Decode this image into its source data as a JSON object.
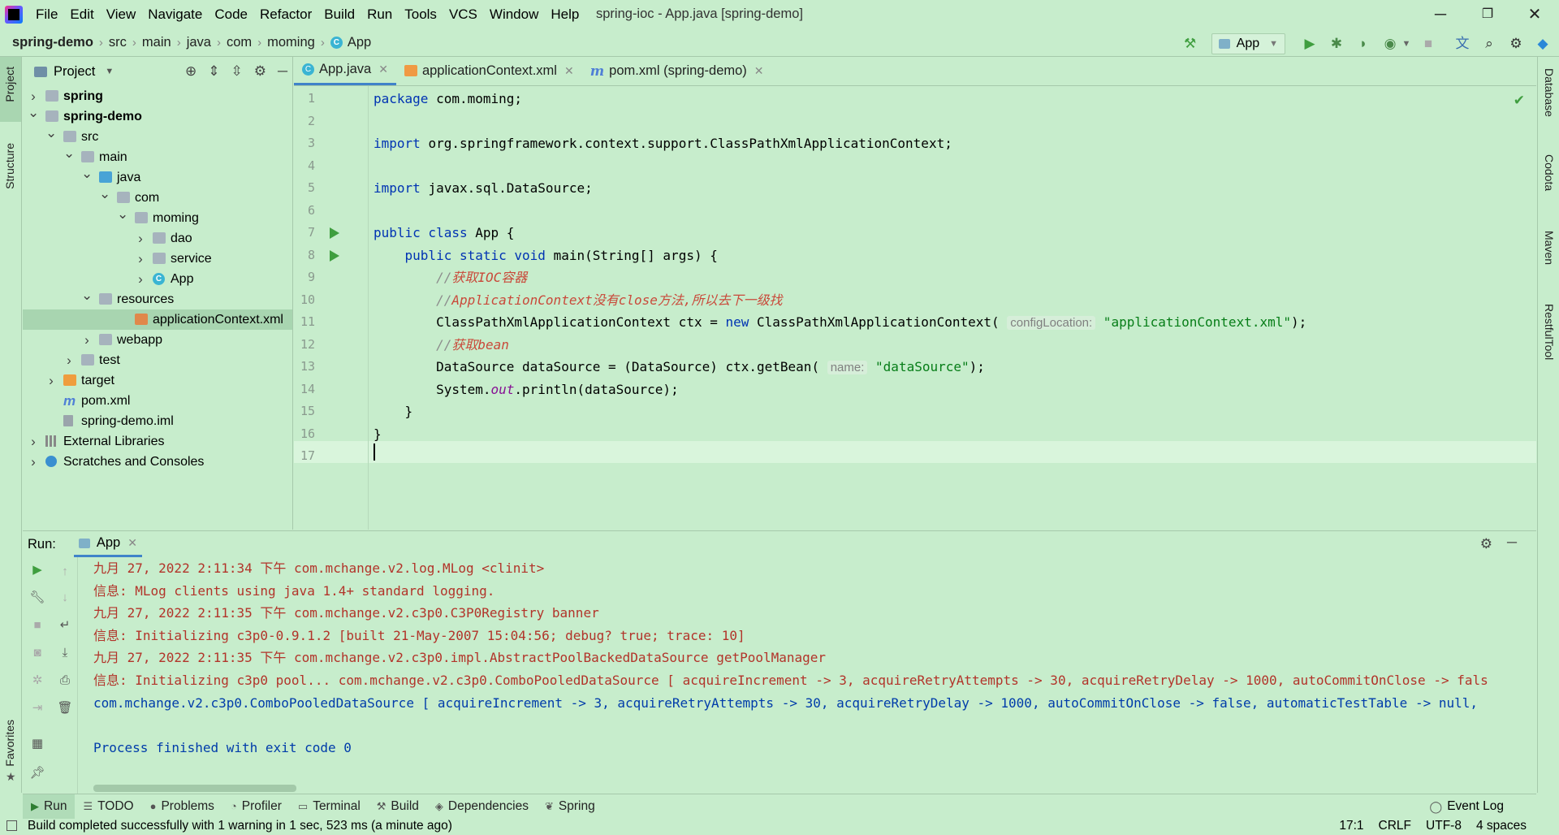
{
  "window": {
    "title": "spring-ioc - App.java [spring-demo]",
    "minimize": "─",
    "restore": "❐",
    "close": "✕"
  },
  "menu": [
    "File",
    "Edit",
    "View",
    "Navigate",
    "Code",
    "Refactor",
    "Build",
    "Run",
    "Tools",
    "VCS",
    "Window",
    "Help"
  ],
  "breadcrumb": [
    "spring-demo",
    "src",
    "main",
    "java",
    "com",
    "moming",
    "App"
  ],
  "run_config": "App",
  "project_panel": {
    "title": "Project",
    "tree": [
      {
        "label": "spring",
        "bold": true,
        "depth": 0,
        "arrow": "›",
        "icon": "folder"
      },
      {
        "label": "spring-demo",
        "bold": true,
        "depth": 0,
        "arrow": "⌄",
        "icon": "folder"
      },
      {
        "label": "src",
        "depth": 1,
        "arrow": "⌄",
        "icon": "folder"
      },
      {
        "label": "main",
        "depth": 2,
        "arrow": "⌄",
        "icon": "folder"
      },
      {
        "label": "java",
        "depth": 3,
        "arrow": "⌄",
        "icon": "folder-blue"
      },
      {
        "label": "com",
        "depth": 4,
        "arrow": "⌄",
        "icon": "folder"
      },
      {
        "label": "moming",
        "depth": 5,
        "arrow": "⌄",
        "icon": "folder"
      },
      {
        "label": "dao",
        "depth": 6,
        "arrow": "›",
        "icon": "folder"
      },
      {
        "label": "service",
        "depth": 6,
        "arrow": "›",
        "icon": "folder"
      },
      {
        "label": "App",
        "depth": 6,
        "arrow": "›",
        "icon": "class"
      },
      {
        "label": "resources",
        "depth": 3,
        "arrow": "⌄",
        "icon": "folder"
      },
      {
        "label": "applicationContext.xml",
        "depth": 5,
        "arrow": "",
        "icon": "xml",
        "selected": true
      },
      {
        "label": "webapp",
        "depth": 3,
        "arrow": "›",
        "icon": "folder"
      },
      {
        "label": "test",
        "depth": 2,
        "arrow": "›",
        "icon": "folder"
      },
      {
        "label": "target",
        "depth": 1,
        "arrow": "›",
        "icon": "folder-orange"
      },
      {
        "label": "pom.xml",
        "depth": 1,
        "arrow": "",
        "icon": "maven"
      },
      {
        "label": "spring-demo.iml",
        "depth": 1,
        "arrow": "",
        "icon": "iml"
      },
      {
        "label": "External Libraries",
        "depth": 0,
        "arrow": "›",
        "icon": "libs"
      },
      {
        "label": "Scratches and Consoles",
        "depth": 0,
        "arrow": "›",
        "icon": "scratch"
      }
    ]
  },
  "editor_tabs": [
    {
      "label": "App.java",
      "icon": "class",
      "active": true
    },
    {
      "label": "applicationContext.xml",
      "icon": "xml"
    },
    {
      "label": "pom.xml (spring-demo)",
      "icon": "maven"
    }
  ],
  "code_lines": [
    [
      [
        "kw",
        "package "
      ],
      [
        "p",
        "com.moming;"
      ]
    ],
    [],
    [
      [
        "kw",
        "import "
      ],
      [
        "p",
        "org.springframework.context.support.ClassPathXmlApplicationContext;"
      ]
    ],
    [],
    [
      [
        "kw",
        "import "
      ],
      [
        "p",
        "javax.sql.DataSource;"
      ]
    ],
    [],
    [
      [
        "kw",
        "public class "
      ],
      [
        "p",
        "App {"
      ]
    ],
    [
      [
        "p",
        "    "
      ],
      [
        "kw",
        "public static void "
      ],
      [
        "p",
        "main(String[] args) {"
      ]
    ],
    [
      [
        "p",
        "        "
      ],
      [
        "cmt",
        "//"
      ],
      [
        "cmt-cn",
        "获取IOC容器"
      ]
    ],
    [
      [
        "p",
        "        "
      ],
      [
        "cmt",
        "//"
      ],
      [
        "cmt-cn",
        "ApplicationContext没有close方法,所以去下一级找"
      ]
    ],
    [
      [
        "p",
        "        ClassPathXmlApplicationContext ctx = "
      ],
      [
        "kw",
        "new "
      ],
      [
        "p",
        "ClassPathXmlApplicationContext( "
      ],
      [
        "hint",
        "configLocation:"
      ],
      [
        "str",
        " \"applicationContext.xml\""
      ],
      [
        "p",
        ");"
      ]
    ],
    [
      [
        "p",
        "        "
      ],
      [
        "cmt",
        "//"
      ],
      [
        "cmt-cn",
        "获取bean"
      ]
    ],
    [
      [
        "p",
        "        DataSource dataSource = (DataSource) ctx.getBean( "
      ],
      [
        "hint",
        "name:"
      ],
      [
        "str",
        " \"dataSource\""
      ],
      [
        "p",
        ");"
      ]
    ],
    [
      [
        "p",
        "        System."
      ],
      [
        "field",
        "out"
      ],
      [
        "p",
        ".println(dataSource);"
      ]
    ],
    [
      [
        "p",
        "    }"
      ]
    ],
    [
      [
        "p",
        "}"
      ]
    ],
    []
  ],
  "run_panel": {
    "label": "Run:",
    "tab": "App",
    "console": [
      {
        "c": "red",
        "t": "九月 27, 2022 2:11:34 下午 com.mchange.v2.log.MLog <clinit>"
      },
      {
        "c": "red",
        "t": "信息: MLog clients using java 1.4+ standard logging."
      },
      {
        "c": "red",
        "t": "九月 27, 2022 2:11:35 下午 com.mchange.v2.c3p0.C3P0Registry banner"
      },
      {
        "c": "red",
        "t": "信息: Initializing c3p0-0.9.1.2 [built 21-May-2007 15:04:56; debug? true; trace: 10]"
      },
      {
        "c": "red",
        "t": "九月 27, 2022 2:11:35 下午 com.mchange.v2.c3p0.impl.AbstractPoolBackedDataSource getPoolManager"
      },
      {
        "c": "red",
        "t": "信息: Initializing c3p0 pool... com.mchange.v2.c3p0.ComboPooledDataSource [ acquireIncrement -> 3, acquireRetryAttempts -> 30, acquireRetryDelay -> 1000, autoCommitOnClose -> fals"
      },
      {
        "c": "blue",
        "t": "com.mchange.v2.c3p0.ComboPooledDataSource [ acquireIncrement -> 3, acquireRetryAttempts -> 30, acquireRetryDelay -> 1000, autoCommitOnClose -> false, automaticTestTable -> null,"
      },
      {
        "c": "blue",
        "t": ""
      },
      {
        "c": "blue",
        "t": "Process finished with exit code 0"
      }
    ]
  },
  "side_tabs_left": [
    "Project",
    "Structure",
    "Favorites"
  ],
  "side_tabs_right": [
    "Database",
    "Codota",
    "Maven",
    "RestfulTool"
  ],
  "bottom_tabs": [
    {
      "label": "Run",
      "icon": "▶",
      "active": true
    },
    {
      "label": "TODO",
      "icon": "☰"
    },
    {
      "label": "Problems",
      "icon": "●"
    },
    {
      "label": "Profiler",
      "icon": "◔"
    },
    {
      "label": "Terminal",
      "icon": "▭"
    },
    {
      "label": "Build",
      "icon": "⚒"
    },
    {
      "label": "Dependencies",
      "icon": "◈"
    },
    {
      "label": "Spring",
      "icon": "❦"
    }
  ],
  "event_log": "Event Log",
  "status": {
    "message": "Build completed successfully with 1 warning in 1 sec, 523 ms (a minute ago)",
    "position": "17:1",
    "line_sep": "CRLF",
    "encoding": "UTF-8",
    "indent": "4 spaces"
  }
}
